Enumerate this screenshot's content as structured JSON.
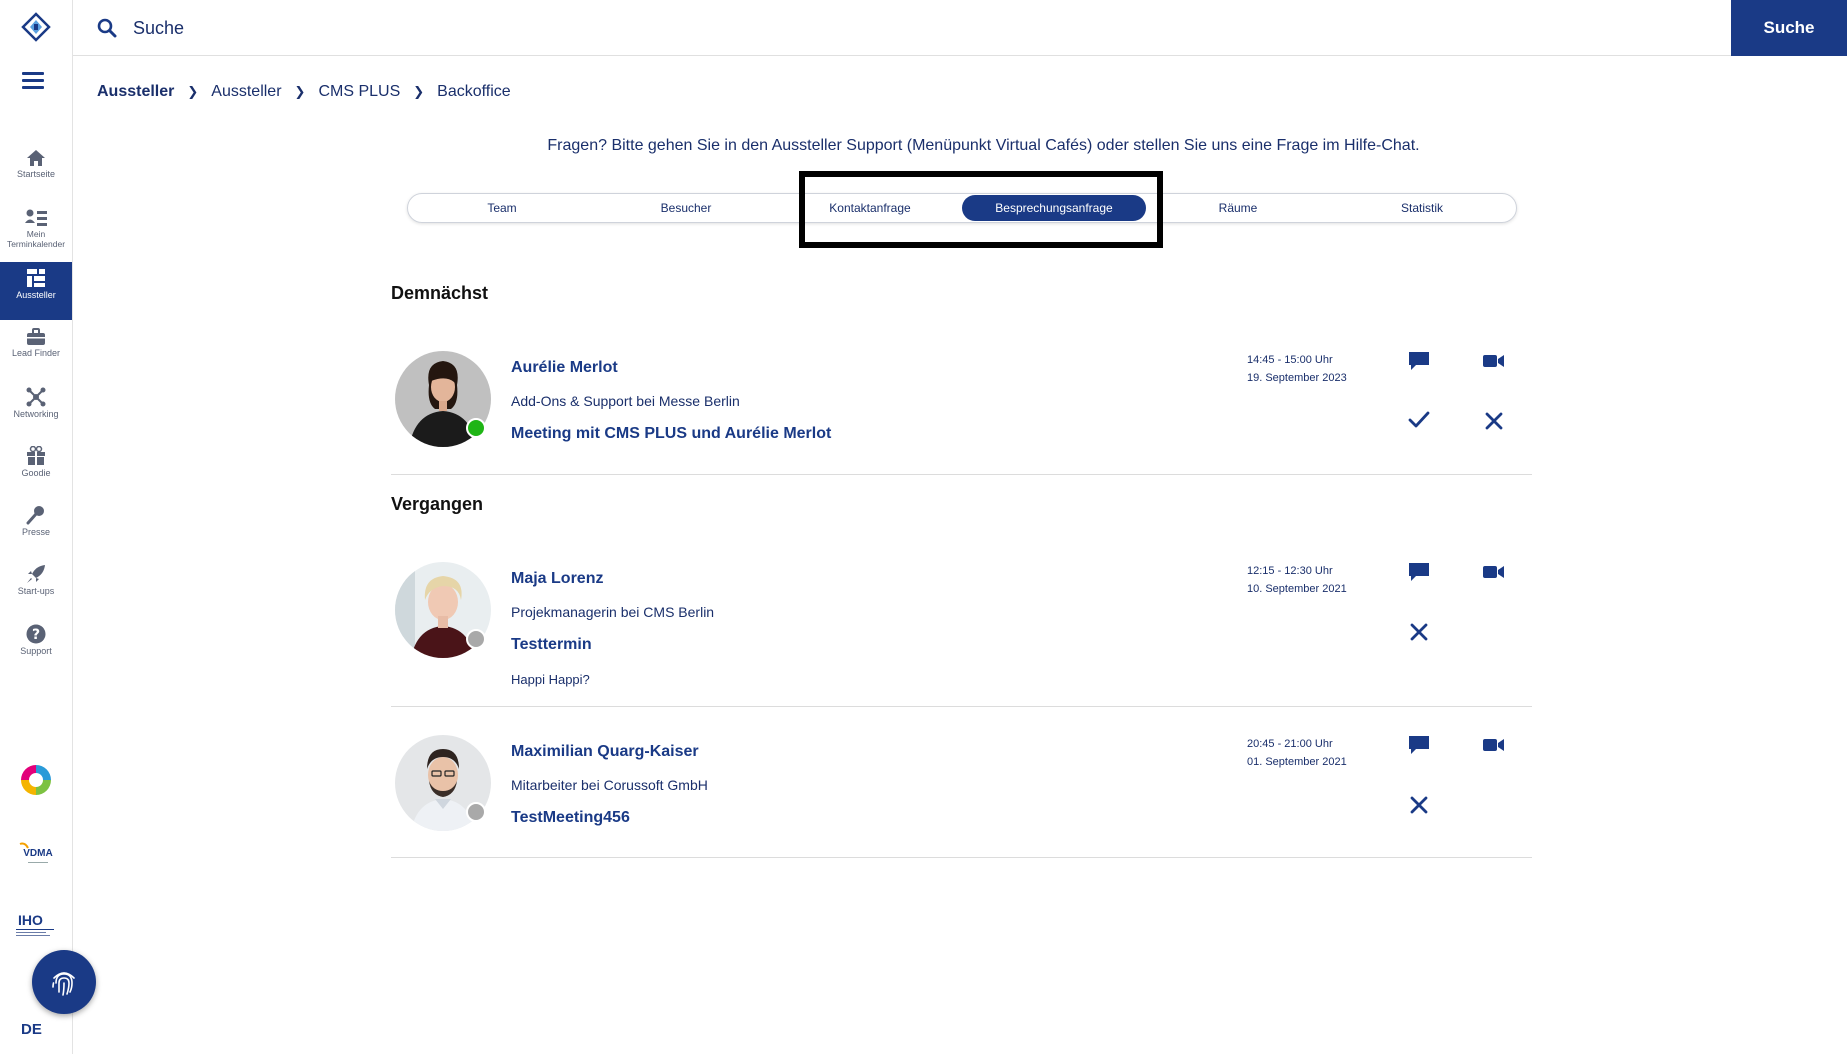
{
  "search": {
    "placeholder": "Suche",
    "button_label": "Suche"
  },
  "sidebar": {
    "items": [
      {
        "label": "Startseite",
        "icon": "home-icon"
      },
      {
        "label": "Mein Terminkalender",
        "icon": "calendar-list-icon"
      },
      {
        "label": "Aussteller",
        "icon": "exhibitor-icon",
        "active": true
      },
      {
        "label": "Lead Finder",
        "icon": "briefcase-icon"
      },
      {
        "label": "Networking",
        "icon": "network-icon"
      },
      {
        "label": "Goodie",
        "icon": "gift-icon"
      },
      {
        "label": "Presse",
        "icon": "microphone-icon"
      },
      {
        "label": "Start-ups",
        "icon": "rocket-icon"
      },
      {
        "label": "Support",
        "icon": "help-icon"
      }
    ],
    "language": "DE",
    "partner_logos": {
      "vdma": "VDMA",
      "iho": "IHO"
    }
  },
  "breadcrumb": [
    "Aussteller",
    "Aussteller",
    "CMS PLUS",
    "Backoffice"
  ],
  "notice": "Fragen? Bitte gehen Sie in den Aussteller Support (Menüpunkt Virtual Cafés) oder stellen Sie uns eine Frage im Hilfe-Chat.",
  "tabs": [
    "Team",
    "Besucher",
    "Kontaktanfrage",
    "Besprechungsanfrage",
    "Räume",
    "Statistik"
  ],
  "active_tab": "Besprechungsanfrage",
  "sections": {
    "upcoming": {
      "title": "Demnächst",
      "items": [
        {
          "name": "Aurélie Merlot",
          "role": "Add-Ons & Support bei Messe Berlin",
          "meeting": "Meeting mit CMS PLUS und Aurélie Merlot",
          "time": "14:45 - 15:00 Uhr",
          "date": "19. September 2023",
          "online": true
        }
      ]
    },
    "past": {
      "title": "Vergangen",
      "items": [
        {
          "name": "Maja Lorenz",
          "role": "Projekmanagerin bei CMS Berlin",
          "meeting": "Testtermin",
          "note": "Happi Happi?",
          "time": "12:15 - 12:30 Uhr",
          "date": "10. September 2021",
          "online": false
        },
        {
          "name": "Maximilian Quarg-Kaiser",
          "role": "Mitarbeiter bei Corussoft GmbH",
          "meeting": "TestMeeting456",
          "time": "20:45 - 21:00 Uhr",
          "date": "01. September 2021",
          "online": false
        }
      ]
    }
  },
  "colors": {
    "primary": "#1a3a86",
    "online": "#1fb515",
    "offline": "#a9a9a9"
  }
}
